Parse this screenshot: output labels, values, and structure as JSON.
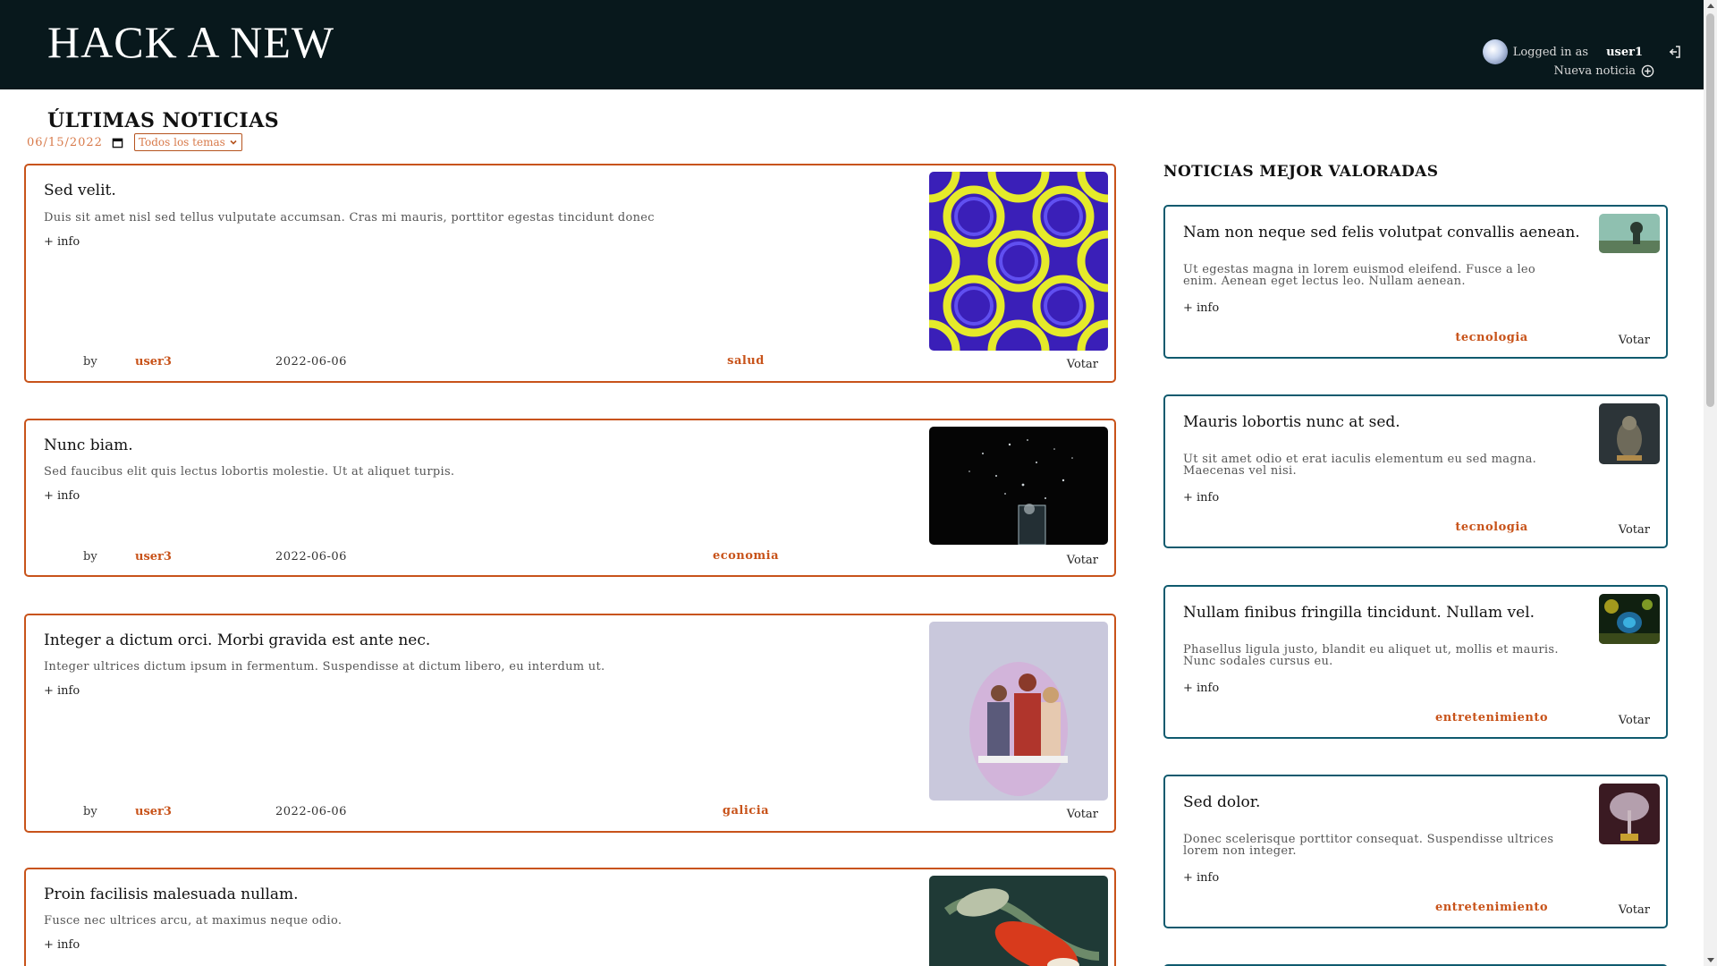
{
  "header": {
    "logo": "HACK A NEW",
    "logged_in_label": "Logged in as",
    "username": "user1",
    "new_news_label": "Nueva noticia"
  },
  "main": {
    "title": "ÚLTIMAS NOTICIAS",
    "date_filter": "06/15/2022",
    "topic_filter": "Todos los temas",
    "news": [
      {
        "title": "Sed velit.",
        "description": "Duis sit amet nisl sed tellus vulputate accumsan. Cras mi mauris, porttitor egestas tincidunt donec",
        "more": "+ info",
        "by": "by",
        "user": "user3",
        "date": "2022-06-06",
        "topic": "salud",
        "vote": "Votar"
      },
      {
        "title": "Nunc biam.",
        "description": "Sed faucibus elit quis lectus lobortis molestie. Ut at aliquet turpis.",
        "more": "+ info",
        "by": "by",
        "user": "user3",
        "date": "2022-06-06",
        "topic": "economia",
        "vote": "Votar"
      },
      {
        "title": "Integer a dictum orci. Morbi gravida est ante nec.",
        "description": "Integer ultrices dictum ipsum in fermentum. Suspendisse at dictum libero, eu interdum ut.",
        "more": "+ info",
        "by": "by",
        "user": "user3",
        "date": "2022-06-06",
        "topic": "galicia",
        "vote": "Votar"
      },
      {
        "title": "Proin facilisis malesuada nullam.",
        "description": "Fusce nec ultrices arcu, at maximus neque odio.",
        "more": "+ info"
      }
    ]
  },
  "sidebar": {
    "title": "NOTICIAS MEJOR VALORADAS",
    "items": [
      {
        "title": "Nam non neque sed felis volutpat convallis aenean.",
        "description": "Ut egestas magna in lorem euismod eleifend. Fusce a leo enim. Aenean eget lectus leo. Nullam aenean.",
        "more": "+ info",
        "topic": "tecnologia",
        "vote": "Votar"
      },
      {
        "title": "Mauris lobortis nunc at sed.",
        "description": "Ut sit amet odio et erat iaculis elementum eu sed magna. Maecenas vel nisi.",
        "more": "+ info",
        "topic": "tecnologia",
        "vote": "Votar"
      },
      {
        "title": "Nullam finibus fringilla tincidunt. Nullam vel.",
        "description": "Phasellus ligula justo, blandit eu aliquet ut, mollis et mauris. Nunc sodales cursus eu.",
        "more": "+ info",
        "topic": "entretenimiento",
        "vote": "Votar"
      },
      {
        "title": "Sed dolor.",
        "description": "Donec scelerisque porttitor consequat. Suspendisse ultrices lorem non integer.",
        "more": "+ info",
        "topic": "entretenimiento",
        "vote": "Votar"
      }
    ]
  },
  "colors": {
    "header_bg": "#08181c",
    "accent_orange": "#c8531a",
    "accent_teal": "#0f5a6e"
  }
}
